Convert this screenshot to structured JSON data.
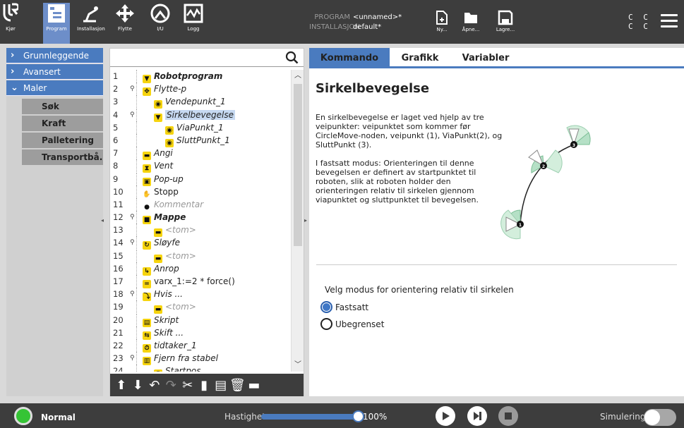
{
  "header": {
    "nav": [
      {
        "id": "logo",
        "label": ""
      },
      {
        "id": "kjor",
        "label": "Kjør"
      },
      {
        "id": "program",
        "label": "Program"
      },
      {
        "id": "installasjon",
        "label": "Installasjon"
      },
      {
        "id": "flytte",
        "label": "Flytte"
      },
      {
        "id": "io",
        "label": "I/U"
      },
      {
        "id": "logg",
        "label": "Logg"
      }
    ],
    "program_key": "PROGRAM",
    "program_value": "<unnamed>*",
    "installation_key": "INSTALLASJON",
    "installation_value": "default*",
    "file_buttons": [
      {
        "label": "Ny...",
        "icon": "new-file-icon"
      },
      {
        "label": "Åpne...",
        "icon": "folder-icon"
      },
      {
        "label": "Lagre...",
        "icon": "save-icon"
      }
    ],
    "cc_line1": "C C",
    "cc_line2": "C C"
  },
  "left_menu": {
    "categories": [
      {
        "label": "Grunnleggende",
        "expanded": false
      },
      {
        "label": "Avansert",
        "expanded": false
      },
      {
        "label": "Maler",
        "expanded": true
      }
    ],
    "sub_items": [
      "Søk",
      "Kraft",
      "Palletering",
      "Transportbå..."
    ]
  },
  "tree": {
    "search_value": "",
    "rows": [
      {
        "n": "1",
        "text": "Robotprogram",
        "icon": "triangle",
        "style": "b",
        "indent": 0
      },
      {
        "n": "2",
        "text": "Flytte-p",
        "icon": "move",
        "style": "it",
        "indent": 0,
        "pin": true
      },
      {
        "n": "3",
        "text": "Vendepunkt_1",
        "icon": "target",
        "style": "it",
        "indent": 1
      },
      {
        "n": "4",
        "text": "Sirkelbevegelse",
        "icon": "triangle",
        "style": "it",
        "indent": 1,
        "pin": true,
        "selected": true
      },
      {
        "n": "5",
        "text": "ViaPunkt_1",
        "icon": "target",
        "style": "it",
        "indent": 2
      },
      {
        "n": "6",
        "text": "SluttPunkt_1",
        "icon": "target",
        "style": "it",
        "indent": 2
      },
      {
        "n": "7",
        "text": "Angi",
        "icon": "dash",
        "style": "it",
        "indent": 0
      },
      {
        "n": "8",
        "text": "Vent",
        "icon": "hourglass",
        "style": "it",
        "indent": 0
      },
      {
        "n": "9",
        "text": "Pop-up",
        "icon": "popup",
        "style": "it",
        "indent": 0
      },
      {
        "n": "10",
        "text": "Stopp",
        "icon": "stop",
        "style": "",
        "indent": 0
      },
      {
        "n": "11",
        "text": "Kommentar",
        "icon": "comment",
        "style": "dim",
        "indent": 0
      },
      {
        "n": "12",
        "text": "Mappe",
        "icon": "folder",
        "style": "b",
        "indent": 0,
        "pin": true
      },
      {
        "n": "13",
        "text": "<tom>",
        "icon": "dash",
        "style": "dim",
        "indent": 1
      },
      {
        "n": "14",
        "text": "Sløyfe",
        "icon": "loop",
        "style": "it",
        "indent": 0,
        "pin": true
      },
      {
        "n": "15",
        "text": "<tom>",
        "icon": "dash",
        "style": "dim",
        "indent": 1
      },
      {
        "n": "16",
        "text": "Anrop",
        "icon": "call",
        "style": "it",
        "indent": 0
      },
      {
        "n": "17",
        "text": "varx_1:=2 * force()",
        "icon": "assign",
        "style": "",
        "indent": 0
      },
      {
        "n": "18",
        "text": "Hvis ...",
        "icon": "if",
        "style": "it",
        "indent": 0,
        "pin": true
      },
      {
        "n": "19",
        "text": "<tom>",
        "icon": "dash",
        "style": "dim",
        "indent": 1
      },
      {
        "n": "20",
        "text": "Skript",
        "icon": "script",
        "style": "it",
        "indent": 0
      },
      {
        "n": "21",
        "text": "Skift ...",
        "icon": "switch",
        "style": "it",
        "indent": 0
      },
      {
        "n": "22",
        "text": "tidtaker_1",
        "icon": "timer",
        "style": "it",
        "indent": 0
      },
      {
        "n": "23",
        "text": "Fjern fra stabel",
        "icon": "stack",
        "style": "it",
        "indent": 0,
        "pin": true
      },
      {
        "n": "24",
        "text": "Startpos",
        "icon": "target",
        "style": "it",
        "indent": 1
      }
    ],
    "toolbar": [
      {
        "name": "move-up-icon",
        "glyph": "⬆",
        "disabled": false
      },
      {
        "name": "move-down-icon",
        "glyph": "⬇",
        "disabled": false
      },
      {
        "name": "undo-icon",
        "glyph": "↶",
        "disabled": false
      },
      {
        "name": "redo-icon",
        "glyph": "↷",
        "disabled": true
      },
      {
        "name": "cut-icon",
        "glyph": "✂",
        "disabled": false
      },
      {
        "name": "copy-icon",
        "glyph": "▮",
        "disabled": false
      },
      {
        "name": "paste-icon",
        "glyph": "▤",
        "disabled": false
      },
      {
        "name": "delete-icon",
        "glyph": "🗑",
        "disabled": false
      },
      {
        "name": "suppress-icon",
        "glyph": "▬",
        "disabled": false
      }
    ]
  },
  "right_panel": {
    "tabs": [
      "Kommando",
      "Grafikk",
      "Variabler"
    ],
    "active_tab": "Kommando",
    "title": "Sirkelbevegelse",
    "desc_p1": "En sirkelbevegelse er laget ved hjelp av tre veipunkter: veipunktet som kommer før CircleMove-noden, veipunkt (1), ViaPunkt(2), og SluttPunkt (3).",
    "desc_p2": "I fastsatt modus: Orienteringen til denne bevegelsen er definert av startpunktet til roboten, slik at roboten holder den orienteringen relativ til sirkelen gjennom viapunktet og sluttpunktet til bevegelsen.",
    "diagram_points": [
      "1",
      "2",
      "3"
    ],
    "mode_label": "Velg modus for orientering relativ til sirkelen",
    "modes": [
      {
        "label": "Fastsatt",
        "selected": true
      },
      {
        "label": "Ubegrenset",
        "selected": false
      }
    ]
  },
  "footer": {
    "status": "Normal",
    "speed_label": "Hastighet",
    "speed_value": "100%",
    "speed_fraction": 1.0,
    "sim_label": "Simulering",
    "sim_on": false
  },
  "colors": {
    "accent": "#4a7bbf",
    "header_bg": "#3d3d3d",
    "status_green": "#35c435",
    "node_yellow": "#f6d40f"
  }
}
